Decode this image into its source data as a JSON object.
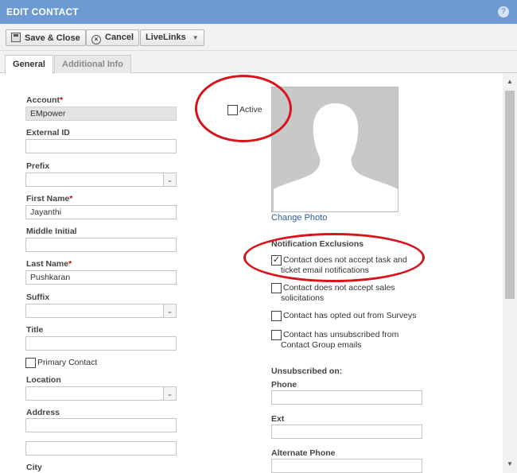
{
  "window": {
    "title": "EDIT CONTACT",
    "help_glyph": "?"
  },
  "toolbar": {
    "save_label": "Save & Close",
    "cancel_label": "Cancel",
    "livelinks_label": "LiveLinks",
    "cancel_glyph": "×",
    "caret_glyph": "▼"
  },
  "tabs": [
    {
      "label": "General",
      "active": true
    },
    {
      "label": "Additional Info",
      "active": false
    }
  ],
  "form": {
    "account": {
      "label": "Account",
      "required_mark": "*",
      "value": "EMpower"
    },
    "external_id": {
      "label": "External ID",
      "value": ""
    },
    "prefix": {
      "label": "Prefix",
      "value": ""
    },
    "first_name": {
      "label": "First Name",
      "required_mark": "*",
      "value": "Jayanthi"
    },
    "middle_initial": {
      "label": "Middle Initial",
      "value": ""
    },
    "last_name": {
      "label": "Last Name",
      "required_mark": "*",
      "value": "Pushkaran"
    },
    "suffix": {
      "label": "Suffix",
      "value": ""
    },
    "title": {
      "label": "Title",
      "value": ""
    },
    "primary_contact": {
      "label": "Primary Contact",
      "checked": false
    },
    "location": {
      "label": "Location",
      "value": ""
    },
    "address": {
      "label": "Address",
      "line1": "",
      "line2": ""
    },
    "city": {
      "label": "City"
    },
    "select_arrow": "⌄"
  },
  "active": {
    "label": "Active",
    "checked": false
  },
  "photo": {
    "change_label": "Change Photo"
  },
  "notifications": {
    "heading": "Notification Exclusions",
    "items": [
      {
        "line1": "Contact does not accept task and",
        "line2": "ticket email notifications",
        "checked": true
      },
      {
        "line1": "Contact does not accept sales",
        "line2": "solicitations",
        "checked": false
      },
      {
        "line1": "Contact has opted out from Surveys",
        "line2": "",
        "checked": false
      },
      {
        "line1": "Contact has unsubscribed from",
        "line2": "Contact Group emails",
        "checked": false
      }
    ],
    "check_glyph": "✓"
  },
  "unsubscribed": {
    "heading": "Unsubscribed on:",
    "phone_label": "Phone",
    "ext_label": "Ext",
    "alt_phone_label": "Alternate Phone"
  },
  "scrollbar": {
    "up_glyph": "▲",
    "down_glyph": "▼"
  },
  "colors": {
    "titlebar": "#6b9bd2",
    "annotation_circle": "#d8131a",
    "link": "#2a5f9a",
    "required": "#cc0000"
  }
}
